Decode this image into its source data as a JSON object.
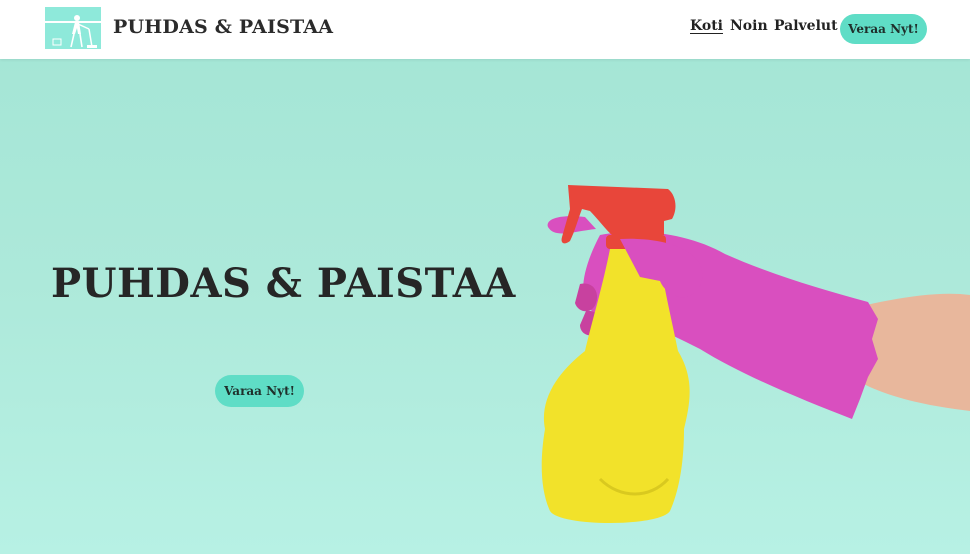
{
  "header": {
    "brand_name": "PUHDAS & PAISTAA",
    "logo_icon": "cleaning-person-logo"
  },
  "nav": {
    "items": [
      {
        "label": "Koti",
        "active": true
      },
      {
        "label": "Noin",
        "active": false
      },
      {
        "label": "Palvelut",
        "active": false
      }
    ],
    "cta_label": "Veraa Nyt!"
  },
  "hero": {
    "title": "PUHDAS & PAISTAA",
    "cta_label": "Varaa Nyt!",
    "image_subject": "gloved-hand-holding-spray-bottle"
  },
  "colors": {
    "accent": "#5fddc6",
    "hero_background": "#a5e6d6",
    "glove": "#d94fbf",
    "bottle": "#f2e22a",
    "trigger": "#e8463a"
  }
}
